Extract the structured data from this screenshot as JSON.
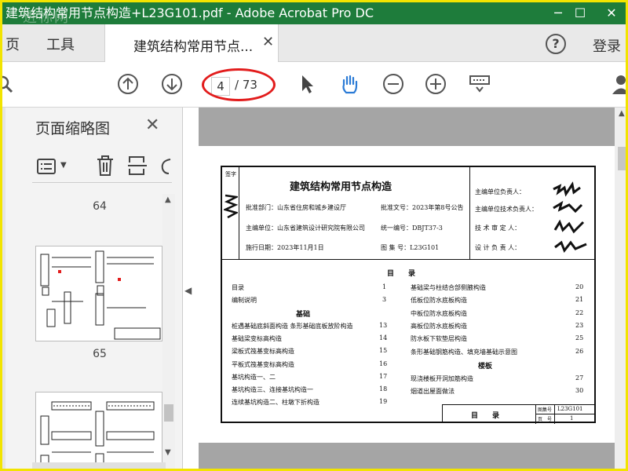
{
  "window": {
    "title": "建筑结构常用节点构造+L23G101.pdf - Adobe Acrobat Pro DC",
    "watermark": "进标网"
  },
  "tabs": {
    "home": "页",
    "tools": "工具",
    "doc": "建筑结构常用节点...",
    "signin": "登录"
  },
  "toolbar": {
    "current_page": "4",
    "total_pages": "/ 73"
  },
  "sidebar": {
    "title": "页面缩略图",
    "thumbs": [
      {
        "label": "64"
      },
      {
        "label": "65"
      }
    ]
  },
  "doc": {
    "title": "建筑结构常用节点构造",
    "approve_dept": "批准部门：山东省住房和城乡建设厅",
    "approve_no": "批准文号：2023年第8号公告",
    "editor_unit": "主编单位：山东省建筑设计研究院有限公司",
    "unified_no": "统一编号：DBJT37-3",
    "impl_date": "施行日期：2023年11月1日",
    "atlas_no": "图 集 号：L23G101",
    "roles": [
      "主编单位负责人：",
      "主编单位技术负责人：",
      "技 术 审 定 人：",
      "设 计 负 责 人："
    ],
    "toc_title": "目　　录",
    "left_items": [
      {
        "text": "目录",
        "page": "1"
      },
      {
        "text": "编制说明",
        "page": "3"
      }
    ],
    "left_section": "基础",
    "left_items2": [
      {
        "text": "桩遇基础底斜面构造 条形基础底板放阶构造",
        "page": "13"
      },
      {
        "text": "基础梁变标高构造",
        "page": "14"
      },
      {
        "text": "梁板式筏基变标高构造",
        "page": "15"
      },
      {
        "text": "平板式筏基变标高构造",
        "page": "16"
      },
      {
        "text": "基坑构造一、二",
        "page": "17"
      },
      {
        "text": "基坑构造三、连接基坑构造一",
        "page": "18"
      },
      {
        "text": "连续基坑构造二、柱墩下折构造",
        "page": "19"
      }
    ],
    "right_items": [
      {
        "text": "基础梁与柱结合部侧腋构造",
        "page": "20"
      },
      {
        "text": "低板位防水底板构造",
        "page": "21"
      },
      {
        "text": "中板位防水底板构造",
        "page": "22"
      },
      {
        "text": "高板位防水底板构造",
        "page": "23"
      },
      {
        "text": "防水板下软垫层构造",
        "page": "25"
      },
      {
        "text": "条形基础钢筋构造、填充墙基础示意图",
        "page": "26"
      }
    ],
    "right_section": "楼板",
    "right_items2": [
      {
        "text": "现浇楼板开洞加筋构造",
        "page": "27"
      },
      {
        "text": "烟道出屋面做法",
        "page": "30"
      }
    ],
    "foot_title": "目　　录",
    "foot_atlas_label": "图集号",
    "foot_atlas_value": "L23G101",
    "foot_page_label": "页　号",
    "foot_page_value": "1",
    "side_strip": "签字"
  }
}
